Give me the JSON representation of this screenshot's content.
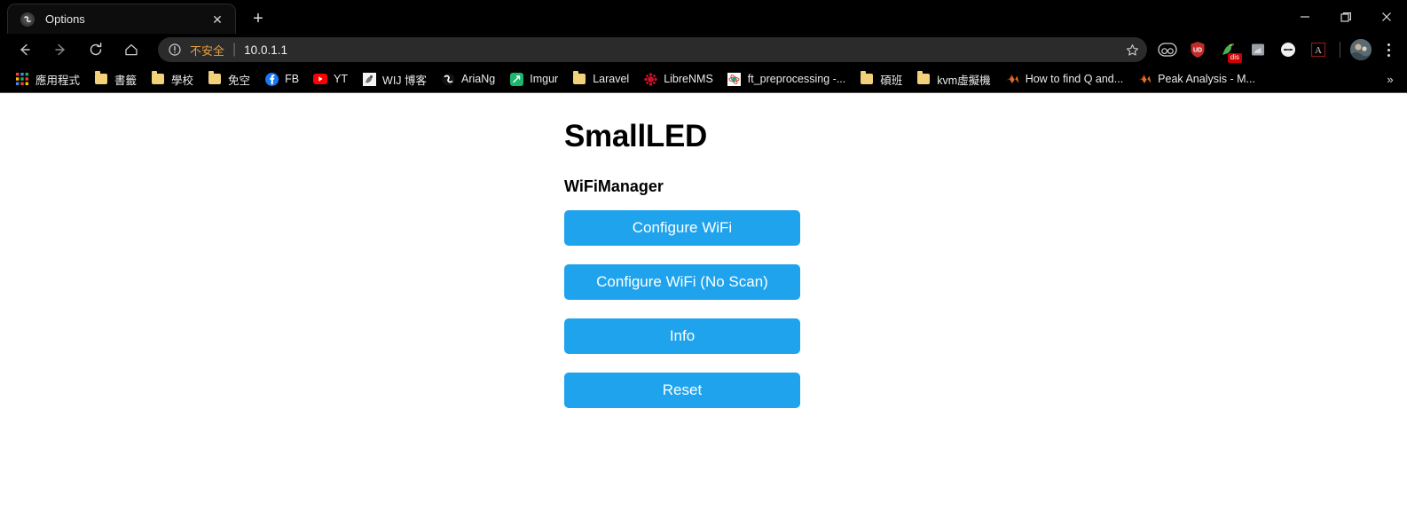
{
  "window": {
    "controls": [
      {
        "name": "minimize",
        "glyph": "—"
      },
      {
        "name": "maximize",
        "glyph": "❐"
      },
      {
        "name": "close",
        "glyph": "✕"
      }
    ]
  },
  "tabstrip": {
    "tabs": [
      {
        "title": "Options",
        "favicon": "swirl-globe-icon",
        "close_glyph": "✕"
      }
    ],
    "new_tab_glyph": "+"
  },
  "toolbar": {
    "back_glyph": "←",
    "forward_glyph": "→",
    "reload_glyph": "⟳",
    "home_glyph": "⌂",
    "omnibox": {
      "security_icon": "info-circle-icon",
      "security_label": "不安全",
      "separator": "|",
      "url": "10.0.1.1",
      "star_glyph": "☆"
    },
    "extensions": [
      {
        "name": "pocket-icon",
        "glyph": "∞",
        "badge": ""
      },
      {
        "name": "ublock-origin-icon",
        "glyph": "UD",
        "badge": ""
      },
      {
        "name": "parrot-extension-icon",
        "glyph": "🦜",
        "badge": "dis"
      },
      {
        "name": "screenshot-extension-icon",
        "glyph": "☐",
        "badge": ""
      },
      {
        "name": "circle-extension-icon",
        "glyph": "⊝",
        "badge": ""
      },
      {
        "name": "adobe-acrobat-icon",
        "glyph": "A",
        "badge": ""
      }
    ],
    "avatar_name": "profile-avatar",
    "menu_name": "chrome-menu-button"
  },
  "bookmarks": {
    "overflow_glyph": "»",
    "items": [
      {
        "label": "應用程式",
        "icon": "apps-grid-icon"
      },
      {
        "label": "書籤",
        "icon": "folder-icon"
      },
      {
        "label": "學校",
        "icon": "folder-icon"
      },
      {
        "label": "免空",
        "icon": "folder-icon"
      },
      {
        "label": "FB",
        "icon": "facebook-icon"
      },
      {
        "label": "YT",
        "icon": "youtube-icon"
      },
      {
        "label": "WIJ 博客",
        "icon": "wij-blog-icon"
      },
      {
        "label": "AriaNg",
        "icon": "ariang-icon"
      },
      {
        "label": "Imgur",
        "icon": "imgur-icon"
      },
      {
        "label": "Laravel",
        "icon": "folder-icon"
      },
      {
        "label": "LibreNMS",
        "icon": "librenms-icon"
      },
      {
        "label": "ft_preprocessing -...",
        "icon": "jupyter-icon"
      },
      {
        "label": "碩班",
        "icon": "folder-icon"
      },
      {
        "label": "kvm虛擬機",
        "icon": "folder-icon"
      },
      {
        "label": "How to find Q and...",
        "icon": "matlab-icon"
      },
      {
        "label": "Peak Analysis - M...",
        "icon": "matlab-icon"
      }
    ]
  },
  "page": {
    "title": "SmallLED",
    "subtitle": "WiFiManager",
    "accent_color": "#1fa3ec",
    "buttons": [
      {
        "label": "Configure WiFi"
      },
      {
        "label": "Configure WiFi (No Scan)"
      },
      {
        "label": "Info"
      },
      {
        "label": "Reset"
      }
    ]
  }
}
